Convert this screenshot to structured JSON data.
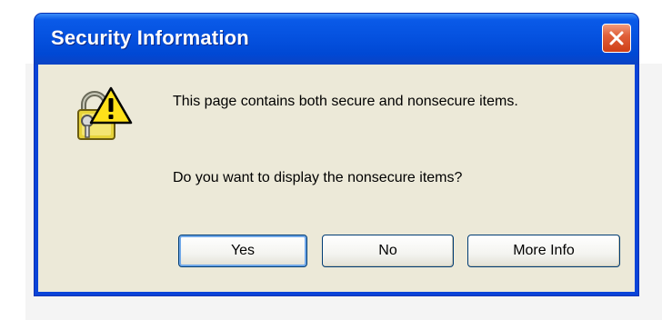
{
  "dialog": {
    "title": "Security Information",
    "icon": "security-lock-warning-icon",
    "message_line1": "This page contains both secure and nonsecure items.",
    "message_line2": "Do you want to display the nonsecure items?"
  },
  "buttons": {
    "yes_label": "Yes",
    "no_label": "No",
    "more_info_label": "More Info",
    "close_icon": "close-icon"
  },
  "colors": {
    "titlebar": "#0552e0",
    "client_background": "#ece9d8",
    "close_button": "#e0603a",
    "button_border": "#003c74"
  }
}
